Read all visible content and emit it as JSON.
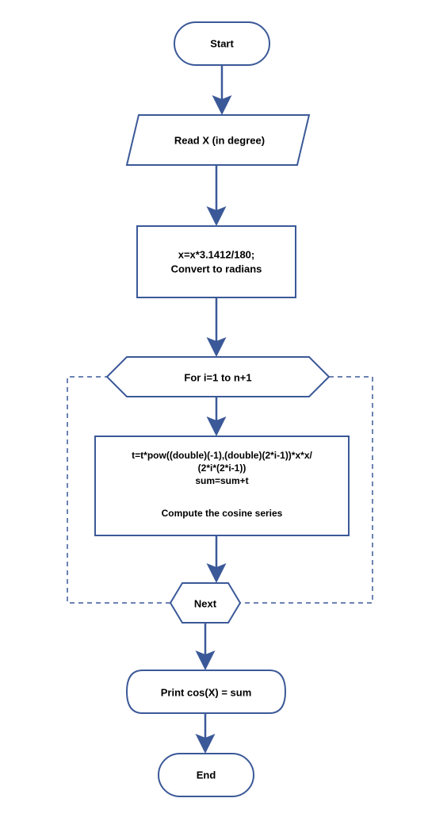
{
  "flowchart": {
    "start": "Start",
    "read": "Read X (in degree)",
    "convert_line1": "x=x*3.1412/180;",
    "convert_line2": "Convert to radians",
    "loop_header": "For i=1 to n+1",
    "compute_line1": "t=t*pow((double)(-1),(double)(2*i-1))*x*x/",
    "compute_line2": "(2*i*(2*i-1))",
    "compute_line3": "sum=sum+t",
    "compute_line4": "Compute the cosine series",
    "next": "Next",
    "print": "Print cos(X) = sum",
    "end": "End"
  },
  "chart_data": {
    "type": "flowchart",
    "title": "Cosine Series Flowchart",
    "nodes": [
      {
        "id": "start",
        "type": "terminator",
        "label": "Start"
      },
      {
        "id": "read",
        "type": "input",
        "label": "Read X (in degree)"
      },
      {
        "id": "convert",
        "type": "process",
        "label": "x=x*3.1412/180; Convert to radians"
      },
      {
        "id": "loop",
        "type": "loop",
        "label": "For i=1 to n+1"
      },
      {
        "id": "compute",
        "type": "process",
        "label": "t=t*pow((double)(-1),(double)(2*i-1))*x*x/(2*i*(2*i-1)) sum=sum+t Compute the cosine series"
      },
      {
        "id": "next",
        "type": "loop",
        "label": "Next"
      },
      {
        "id": "print",
        "type": "output",
        "label": "Print cos(X) = sum"
      },
      {
        "id": "end",
        "type": "terminator",
        "label": "End"
      }
    ],
    "edges": [
      {
        "from": "start",
        "to": "read"
      },
      {
        "from": "read",
        "to": "convert"
      },
      {
        "from": "convert",
        "to": "loop"
      },
      {
        "from": "loop",
        "to": "compute"
      },
      {
        "from": "compute",
        "to": "next"
      },
      {
        "from": "next",
        "to": "loop",
        "type": "loop_back"
      },
      {
        "from": "next",
        "to": "print"
      },
      {
        "from": "print",
        "to": "end"
      }
    ]
  }
}
